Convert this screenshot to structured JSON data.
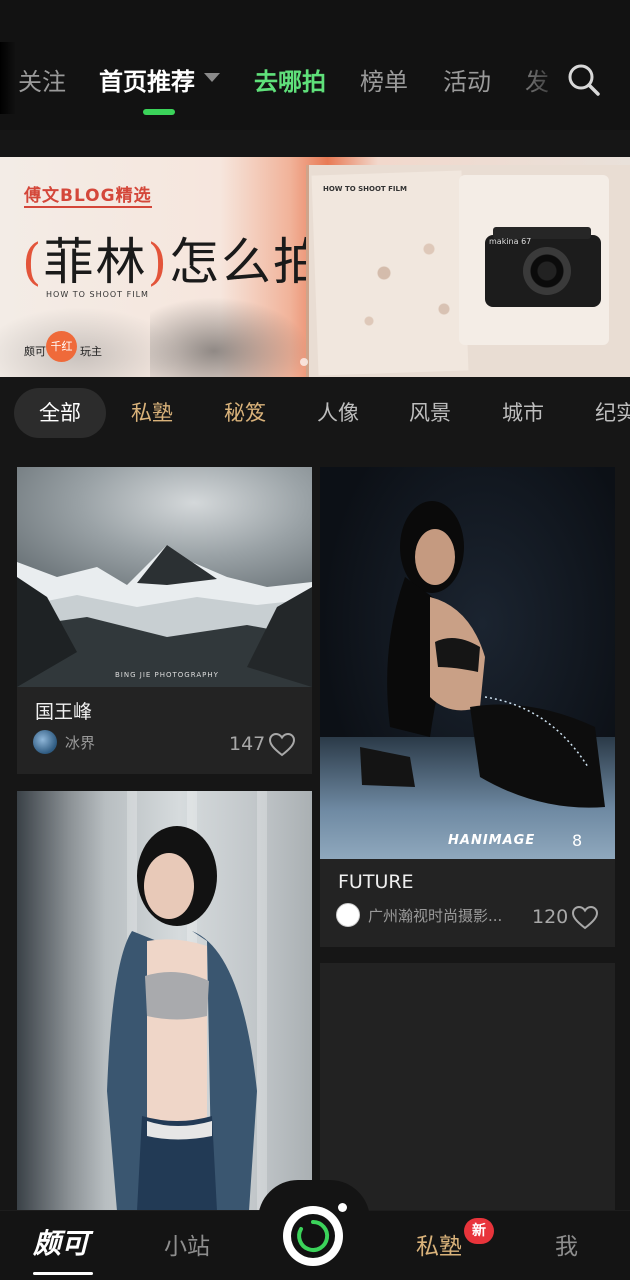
{
  "top_nav": {
    "tabs": [
      {
        "label": "关注"
      },
      {
        "label": "首页推荐"
      },
      {
        "label": "去哪拍"
      },
      {
        "label": "榜单"
      },
      {
        "label": "活动"
      },
      {
        "label": "发"
      }
    ],
    "active_tab": "首页推荐",
    "highlight_tab": "去哪拍",
    "icons": {
      "search": "search-icon",
      "dropdown": "caret-down-icon"
    },
    "colors": {
      "accent": "#3bd35a",
      "highlight": "#5fe07a",
      "background": "#121212"
    }
  },
  "banner": {
    "blog_label": "傅文BLOG精选",
    "title_open": "(",
    "title_main": "菲林",
    "title_close": ")",
    "title_rest": "怎么拍?",
    "title_tm": "™",
    "subtitle": "HOW TO SHOOT FILM",
    "book_caption": "HOW TO SHOOT FILM",
    "brand_left": "颇可",
    "brand_seal": "千红",
    "brand_right": "玩主",
    "camera_label": "makina 67"
  },
  "categories": {
    "items": [
      {
        "label": "全部"
      },
      {
        "label": "私塾"
      },
      {
        "label": "秘笈"
      },
      {
        "label": "人像"
      },
      {
        "label": "风景"
      },
      {
        "label": "城市"
      },
      {
        "label": "纪实"
      }
    ],
    "active": "全部",
    "gold_color": "#d9b27a"
  },
  "feed": [
    {
      "title": "国王峰",
      "author": "冰界",
      "likes": "147",
      "image_watermark": "BING JIE PHOTOGRAPHY"
    },
    {
      "title": "FUTURE",
      "author": "广州瀚视时尚摄影...",
      "likes": "120",
      "image_watermark": "HANIMAGE",
      "image_badge": "8"
    },
    {
      "title": "",
      "author": "",
      "likes": ""
    }
  ],
  "bottom_nav": {
    "items": [
      {
        "label": "颇可"
      },
      {
        "label": "小站"
      },
      {
        "label": "私塾"
      },
      {
        "label": "我"
      }
    ],
    "badge": "新",
    "active": "颇可",
    "icons": {
      "camera": "camera-shutter-icon"
    }
  }
}
